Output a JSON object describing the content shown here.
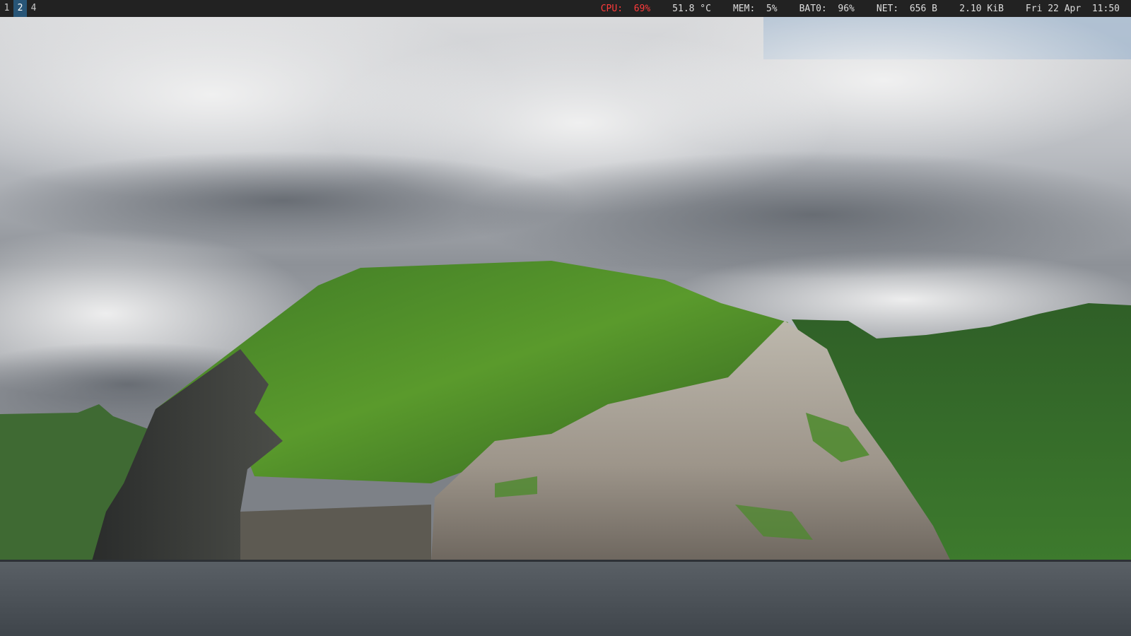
{
  "workspaces": [
    {
      "label": "1",
      "focused": false
    },
    {
      "label": "2",
      "focused": true
    },
    {
      "label": "4",
      "focused": false
    }
  ],
  "status": {
    "cpu_label": "CPU:",
    "cpu_value": "69%",
    "temp": "51.8 °C",
    "mem_label": "MEM:",
    "mem_value": "5%",
    "bat_label": "BAT0:",
    "bat_value": "96%",
    "net_label": "NET:",
    "net_down": "656 B",
    "net_up": "2.10 KiB",
    "date": "Fri 22 Apr",
    "time": "11:50"
  },
  "colors": {
    "bar_bg": "#222222",
    "bar_fg": "#dddddd",
    "focused_ws": "#285577",
    "warning": "#ff3b3b"
  }
}
